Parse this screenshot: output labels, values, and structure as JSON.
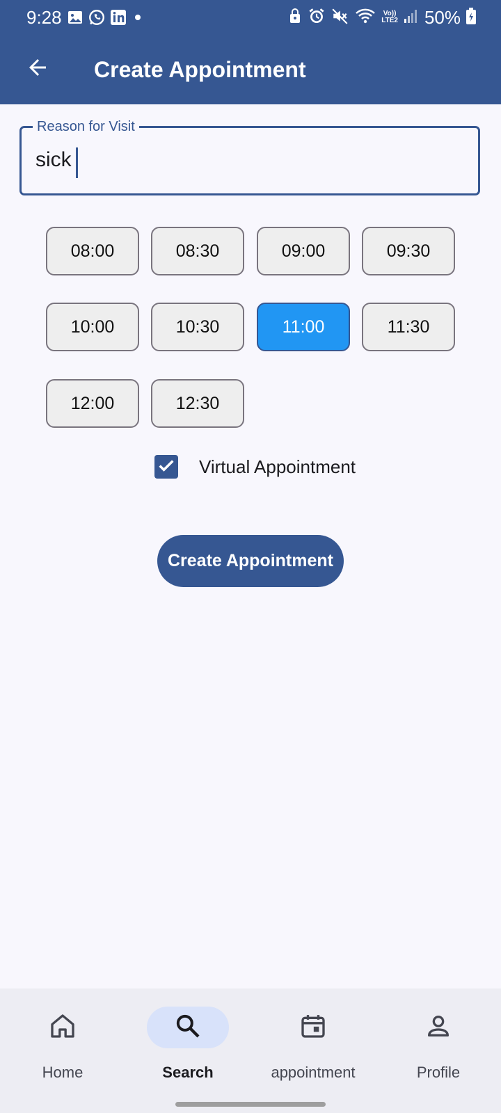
{
  "status_bar": {
    "time": "9:28",
    "battery": "50%",
    "network_top": "Vo))",
    "network_bottom": "LTE2",
    "left_icons": [
      "gallery-icon",
      "whatsapp-icon",
      "linkedin-icon",
      "dot-icon"
    ],
    "right_icons": [
      "lock-icon",
      "alarm-icon",
      "mute-icon",
      "wifi-icon",
      "signal-icon",
      "battery-icon"
    ]
  },
  "app_bar": {
    "title": "Create Appointment",
    "back_icon": "arrow-back-icon",
    "color": "#365792"
  },
  "form": {
    "reason_label": "Reason for Visit",
    "reason_value": "sick"
  },
  "time_slots": {
    "items": [
      "08:00",
      "08:30",
      "09:00",
      "09:30",
      "10:00",
      "10:30",
      "11:00",
      "11:30",
      "12:00",
      "12:30"
    ],
    "selected": "11:00",
    "selected_color": "#2196F3"
  },
  "virtual": {
    "label": "Virtual Appointment",
    "checked": true
  },
  "create_button": {
    "label": "Create Appointment"
  },
  "bottom_nav": {
    "items": [
      {
        "label": "Home",
        "icon": "home-icon"
      },
      {
        "label": "Search",
        "icon": "search-icon"
      },
      {
        "label": "appointment",
        "icon": "calendar-icon"
      },
      {
        "label": "Profile",
        "icon": "person-icon"
      }
    ],
    "active": "Search"
  }
}
